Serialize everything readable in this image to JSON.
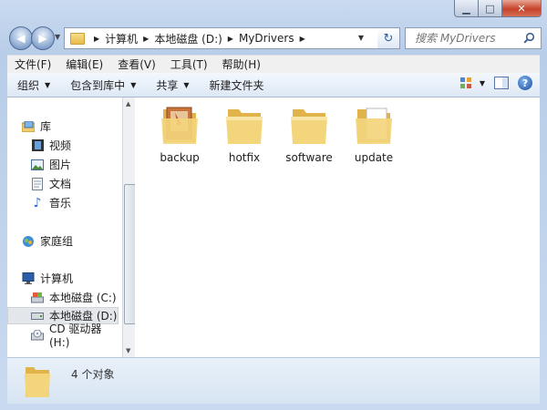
{
  "window": {
    "minimize": "▁",
    "maximize": "□",
    "close": "✕"
  },
  "address": {
    "crumbs": [
      "计算机",
      "本地磁盘 (D:)",
      "MyDrivers"
    ]
  },
  "search": {
    "placeholder": "搜索 MyDrivers"
  },
  "menu": {
    "items": [
      "文件(F)",
      "编辑(E)",
      "查看(V)",
      "工具(T)",
      "帮助(H)"
    ]
  },
  "toolbar": {
    "organize": "组织",
    "include_library": "包含到库中",
    "share": "共享",
    "new_folder": "新建文件夹",
    "help": "?"
  },
  "nav": {
    "libraries": "库",
    "videos": "视频",
    "pictures": "图片",
    "documents": "文档",
    "music": "音乐",
    "homegroup": "家庭组",
    "computer": "计算机",
    "drive_c": "本地磁盘 (C:)",
    "drive_d": "本地磁盘 (D:)",
    "drive_h": "CD 驱动器 (H:)"
  },
  "files": [
    {
      "name": "backup",
      "icon": "folder-with-papers-icon"
    },
    {
      "name": "hotfix",
      "icon": "folder-icon"
    },
    {
      "name": "software",
      "icon": "folder-icon"
    },
    {
      "name": "update",
      "icon": "folder-with-paper-icon"
    }
  ],
  "details": {
    "count": "4 个对象"
  },
  "colors": {
    "accent": "#c6432a",
    "selection": "#e3e6ea",
    "folder": "#f0cc6a"
  }
}
